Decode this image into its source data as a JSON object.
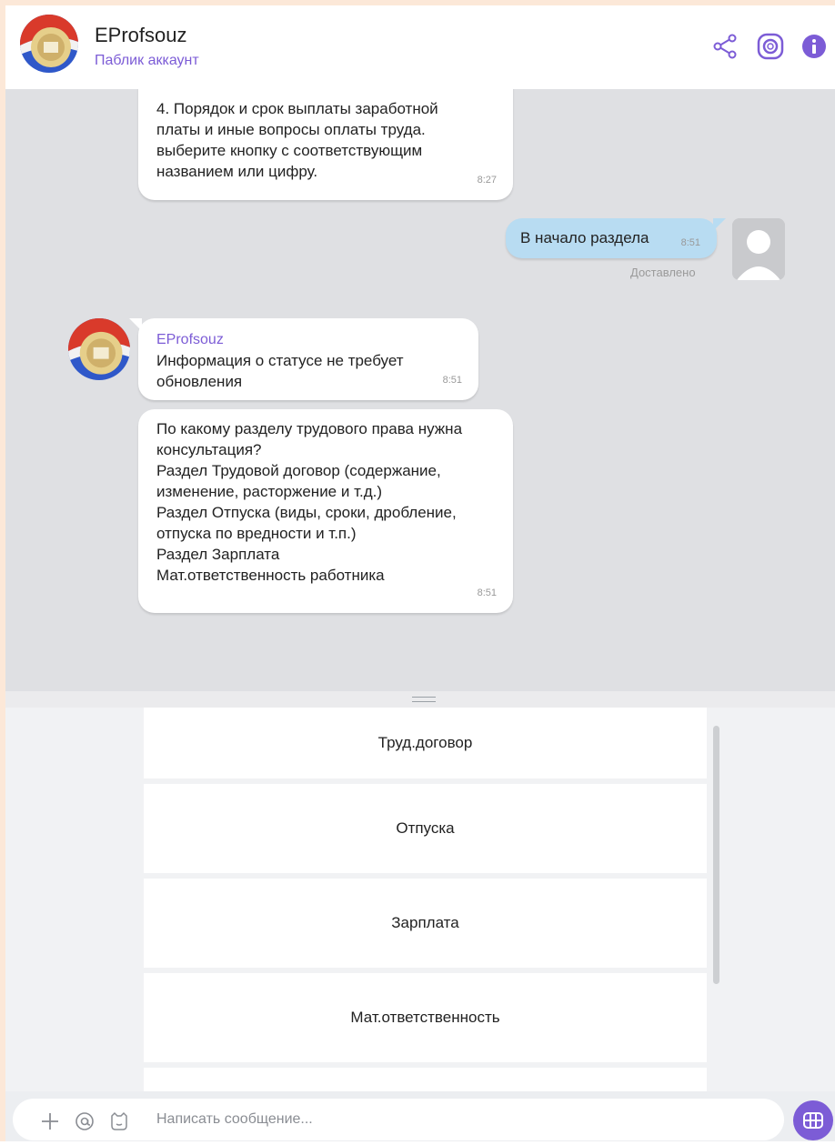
{
  "header": {
    "title": "EProfsouz",
    "subtitle": "Паблик аккаунт",
    "icons": [
      "share-icon",
      "channel-icon",
      "info-icon"
    ]
  },
  "messages": [
    {
      "direction": "in",
      "text": "4. Порядок и срок выплаты заработной\nплаты и иные вопросы оплаты труда.\nвыберите кнопку с соответствующим\nназванием или цифру.",
      "time": "8:27"
    },
    {
      "direction": "out",
      "text": "В начало раздела",
      "time": "8:51",
      "status": "Доставлено"
    },
    {
      "direction": "in",
      "sender": "EProfsouz",
      "text": "Информация о статусе не требует\nобновления",
      "time": "8:51"
    },
    {
      "direction": "in",
      "text": "По какому разделу трудового права нужна\nконсультация?\nРаздел Трудовой договор (содержание,\nизменение, расторжение и т.д.)\nРаздел Отпуска (виды, сроки, дробление,\nотпуска по вредности и т.п.)\nРаздел Зарплата\nМат.ответственность работника",
      "time": "8:51"
    }
  ],
  "keyboard": {
    "buttons": [
      "Труд.договор",
      "Отпуска",
      "Зарплата",
      "Мат.ответственность",
      ""
    ]
  },
  "composer": {
    "placeholder": "Написать сообщение..."
  },
  "colors": {
    "accent": "#7c5cd6",
    "outgoing_bubble": "#b8dcf2",
    "chat_background": "#dfe0e3"
  }
}
